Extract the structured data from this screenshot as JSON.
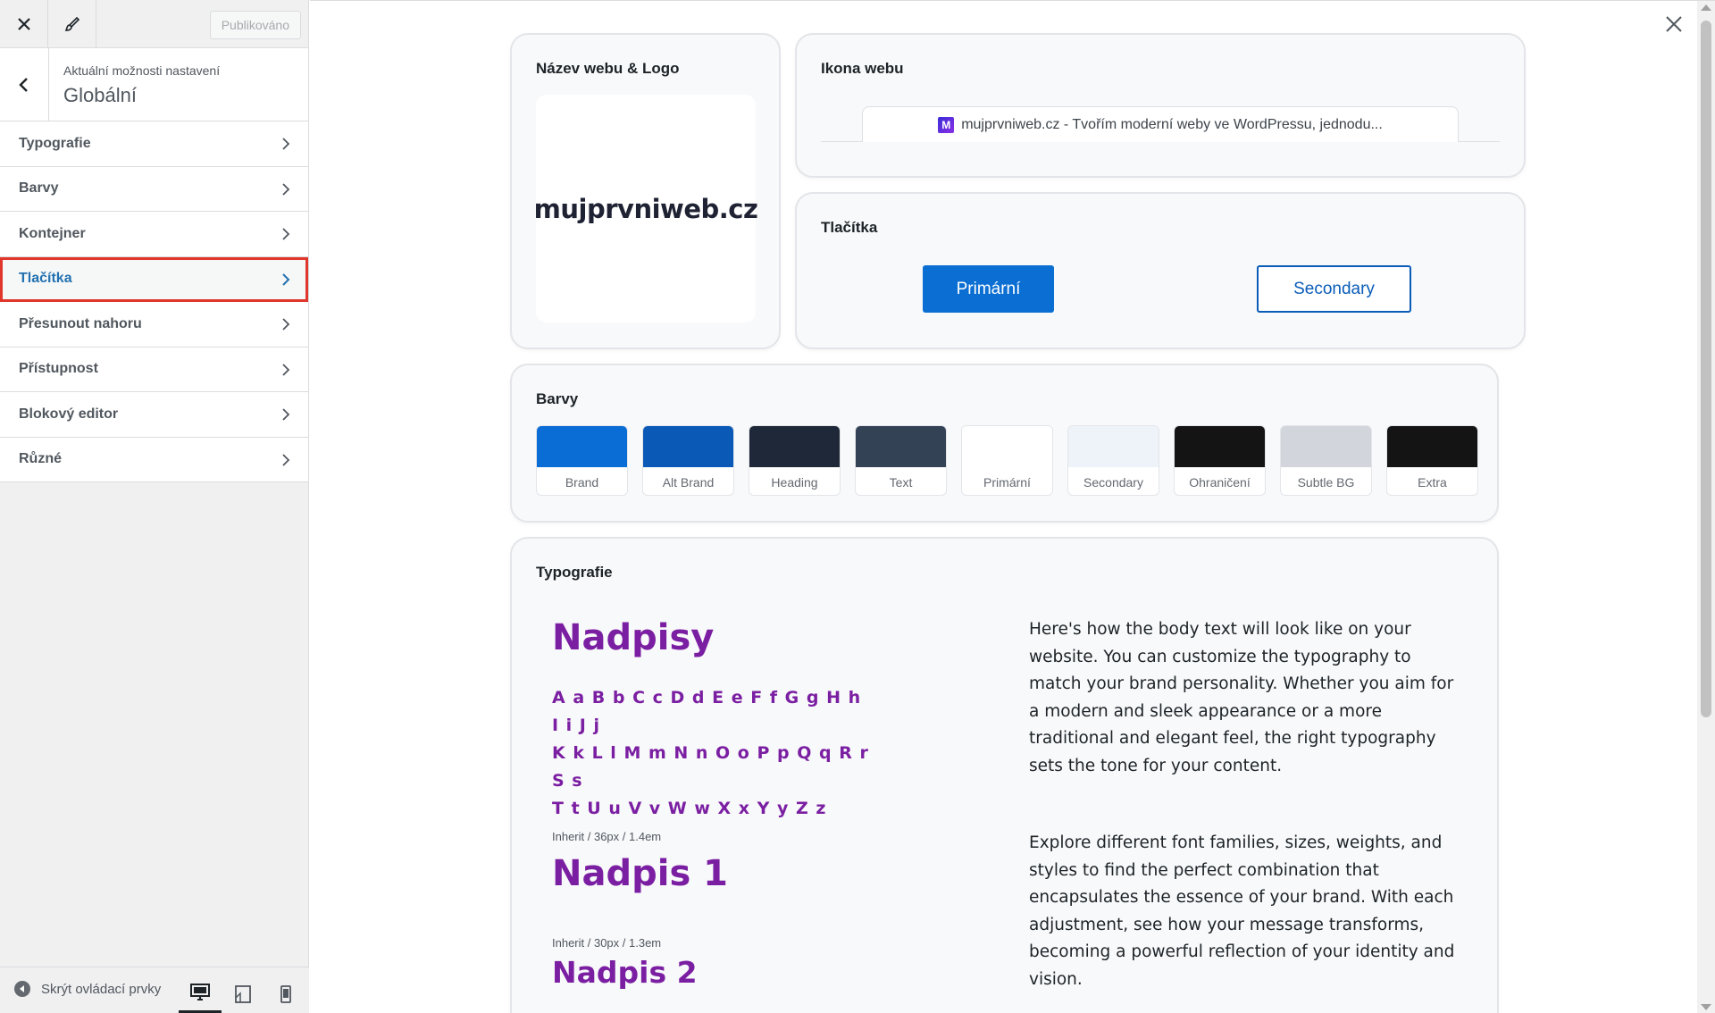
{
  "sidebar": {
    "publish_label": "Publikováno",
    "breadcrumb": "Aktuální možnosti nastavení",
    "section_title": "Globální",
    "items": [
      {
        "label": "Typografie"
      },
      {
        "label": "Barvy"
      },
      {
        "label": "Kontejner"
      },
      {
        "label": "Tlačítka"
      },
      {
        "label": "Přesunout nahoru"
      },
      {
        "label": "Přístupnost"
      },
      {
        "label": "Blokový editor"
      },
      {
        "label": "Různé"
      }
    ],
    "active_item": "Tlačítka",
    "hide_controls_label": "Skrýt ovládací prvky",
    "devices": [
      "desktop",
      "tablet",
      "mobile"
    ],
    "active_device": "desktop"
  },
  "preview": {
    "logo_card": {
      "title": "Název webu & Logo",
      "logo_text": "mujprvniweb.cz"
    },
    "icon_card": {
      "title": "Ikona webu",
      "favicon_letter": "M",
      "tab_text": "mujprvniweb.cz - Tvořím moderní weby ve WordPressu, jednodu..."
    },
    "buttons_card": {
      "title": "Tlačítka",
      "primary_label": "Primární",
      "secondary_label": "Secondary"
    },
    "colors_card": {
      "title": "Barvy",
      "swatches": [
        {
          "label": "Brand",
          "color": "#0a6dd6"
        },
        {
          "label": "Alt Brand",
          "color": "#0a59b6"
        },
        {
          "label": "Heading",
          "color": "#1e2838"
        },
        {
          "label": "Text",
          "color": "#344256"
        },
        {
          "label": "Primární",
          "color": "#ffffff"
        },
        {
          "label": "Secondary",
          "color": "#eef3fa"
        },
        {
          "label": "Ohraničení",
          "color": "#141414"
        },
        {
          "label": "Subtle BG",
          "color": "#d2d5db"
        },
        {
          "label": "Extra",
          "color": "#141414"
        }
      ]
    },
    "typography_card": {
      "title": "Typografie",
      "heading_sample": "Nadpisy",
      "alphabet_lines": [
        "A a B b C c D d E e F f G g H h I i J j",
        "K k L l M m N n O o P p Q q R r S s",
        "T t U u V v W w X x Y y Z z"
      ],
      "h1_meta": "Inherit / 36px / 1.4em",
      "h1_sample": "Nadpis 1",
      "h2_meta": "Inherit / 30px / 1.3em",
      "h2_sample": "Nadpis 2",
      "paragraph_1": "Here's how the body text will look like on your website. You can customize the typography to match your brand personality. Whether you aim for a modern and sleek appearance or a more traditional and elegant feel, the right typography sets the tone for your content.",
      "paragraph_2": "Explore different font families, sizes, weights, and styles to find the perfect combination that encapsulates the essence of your brand. With each adjustment, see how your message transforms, becoming a powerful reflection of your identity and vision."
    }
  },
  "colors": {
    "accent": "#2271b1",
    "highlight_outline": "#e0362c",
    "heading_purple": "#7b1fa2"
  }
}
